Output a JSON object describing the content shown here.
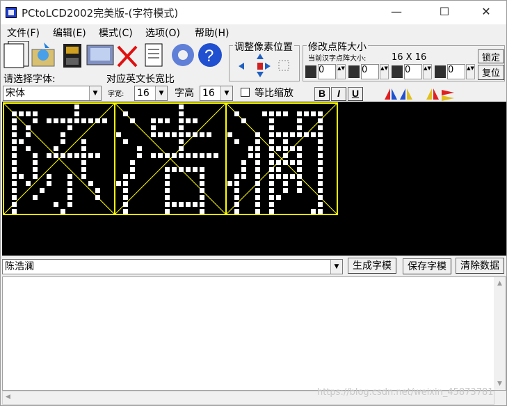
{
  "window": {
    "title": "PCtoLCD2002完美版-(字符模式)",
    "minimize": "—",
    "maximize": "☐",
    "close": "✕"
  },
  "menu": [
    "文件(F)",
    "编辑(E)",
    "模式(C)",
    "选项(O)",
    "帮助(H)"
  ],
  "toolbar": {
    "icons": [
      "new-icon",
      "open-icon",
      "save-icon",
      "export-icon",
      "delete-icon",
      "notes-icon",
      "settings-icon",
      "help-icon"
    ]
  },
  "adjust_group": {
    "label": "调整像素位置"
  },
  "matrix_group": {
    "label": "修改点阵大小",
    "current_label": "当前汉字点阵大小:",
    "current_value": "16  X  16",
    "lock_label": "锁定",
    "reset_label": "复位",
    "spin_values": [
      "0",
      "0",
      "0",
      "0"
    ]
  },
  "font": {
    "select_label": "请选择字体:",
    "font_value": "宋体",
    "ratio_label": "对应英文长宽比",
    "width_label": "字宽:",
    "width_value": "16",
    "height_label": "字高",
    "height_value": "16",
    "proportional_label": "等比缩放",
    "bold": "B",
    "italic": "I",
    "underline": "U"
  },
  "input": {
    "text": "陈浩澜"
  },
  "actions": {
    "generate": "生成字模",
    "save": "保存字模",
    "clear": "清除数据"
  },
  "watermark": "https://blog.csdn.net/weixin_45873781",
  "colors": {
    "grid": "#ffff00",
    "pixel": "#ffffff",
    "canvas_bg": "#000000"
  }
}
